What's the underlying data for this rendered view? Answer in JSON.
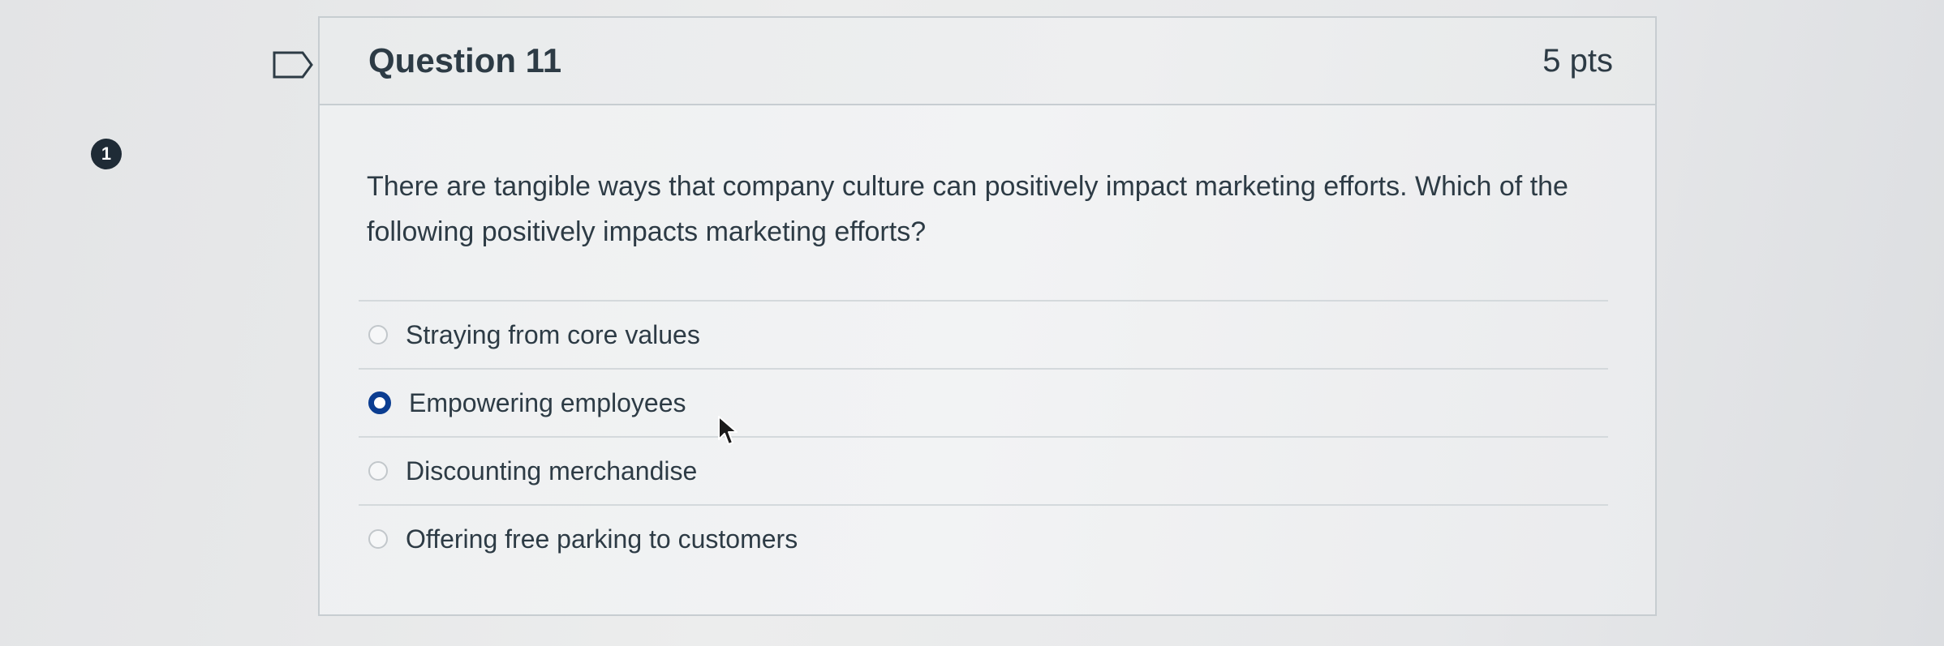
{
  "badge": {
    "number": "1"
  },
  "question": {
    "title": "Question 11",
    "points": "5 pts",
    "text": "There are tangible ways that company culture can positively impact marketing efforts. Which of the following positively impacts marketing efforts?"
  },
  "answers": [
    {
      "label": "Straying from core values",
      "selected": false
    },
    {
      "label": "Empowering employees",
      "selected": true
    },
    {
      "label": "Discounting merchandise",
      "selected": false
    },
    {
      "label": "Offering free parking to customers",
      "selected": false
    }
  ],
  "colors": {
    "selected_radio": "#0b3d91",
    "text": "#2d3b45",
    "border": "#c7cdd1"
  },
  "icons": {
    "flag": "flag-outline-icon",
    "cursor": "mouse-pointer-icon"
  }
}
